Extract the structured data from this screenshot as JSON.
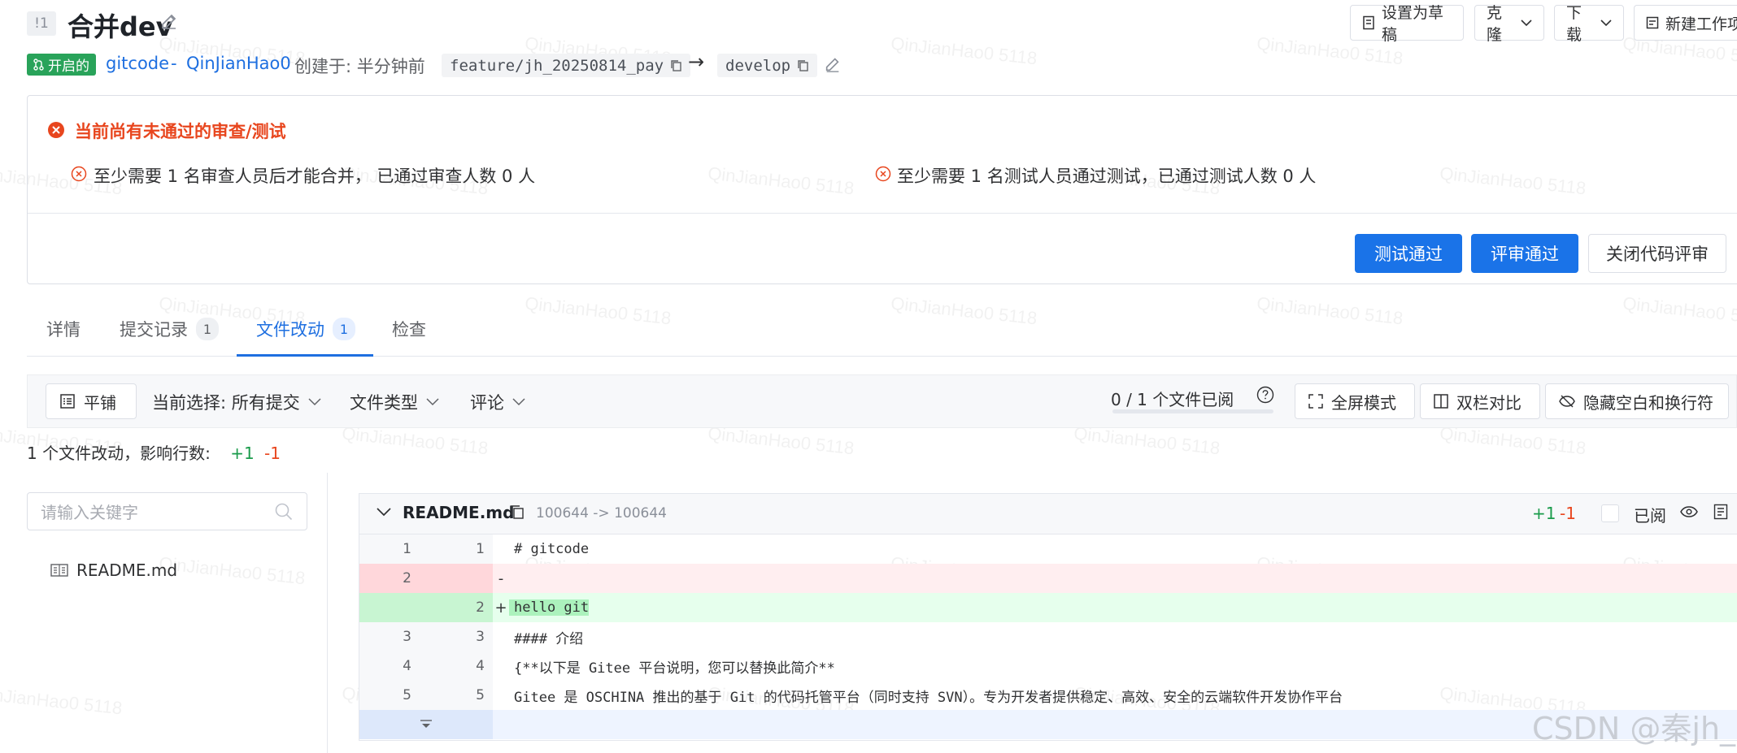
{
  "header": {
    "mr_id": "!1",
    "title": "合并dev",
    "actions": [
      "设置为草稿",
      "克隆",
      "下载",
      "新建工作项"
    ]
  },
  "meta": {
    "status": "开启的",
    "repo": "gitcode",
    "separator": "-",
    "author": "QinJianHao0",
    "created": "创建于: 半分钟前",
    "source_branch": "feature/jh_20250814_pay",
    "arrow": "→",
    "target_branch": "develop"
  },
  "review": {
    "title": "当前尚有未通过的审查/测试",
    "reviewer_rule": "至少需要 1 名审查人员后才能合并， 已通过审查人数 0 人",
    "tester_rule": "至少需要 1 名测试人员通过测试，已通过测试人数 0 人",
    "buttons": [
      "测试通过",
      "评审通过",
      "关闭代码评审"
    ]
  },
  "tabs": [
    {
      "label": "详情",
      "count": null
    },
    {
      "label": "提交记录",
      "count": "1"
    },
    {
      "label": "文件改动",
      "count": "1"
    },
    {
      "label": "检查",
      "count": null
    }
  ],
  "active_tab": "文件改动",
  "toolbar": {
    "layout_label": "平铺",
    "selection_label": "当前选择: 所有提交",
    "file_type_label": "文件类型",
    "comment_label": "评论",
    "viewed_text": "0 / 1 个文件已阅",
    "viewed_fraction": 0,
    "fullscreen_label": "全屏模式",
    "split_label": "双栏对比",
    "hide_whitespace_label": "隐藏空白和换行符"
  },
  "summary": {
    "text": "1 个文件改动，影响行数:",
    "additions": "+1",
    "deletions": "-1"
  },
  "sidebar": {
    "search_placeholder": "请输入关键字",
    "files": [
      "README.md"
    ]
  },
  "diff": {
    "filename": "README.md",
    "mode": "100644 -> 100644",
    "additions": "+1",
    "deletions": "-1",
    "viewed_label": "已阅",
    "lines": [
      {
        "old": "1",
        "new": "1",
        "type": "context",
        "sign": "",
        "text": "# gitcode"
      },
      {
        "old": "2",
        "new": "",
        "type": "del",
        "sign": "-",
        "text": ""
      },
      {
        "old": "",
        "new": "2",
        "type": "add",
        "sign": "+",
        "text": "hello git"
      },
      {
        "old": "3",
        "new": "3",
        "type": "context",
        "sign": "",
        "text": "#### 介绍"
      },
      {
        "old": "4",
        "new": "4",
        "type": "context",
        "sign": "",
        "text": "{**以下是 Gitee 平台说明，您可以替换此简介**"
      },
      {
        "old": "5",
        "new": "5",
        "type": "context",
        "sign": "",
        "text": "Gitee 是 OSCHINA 推出的基于 Git 的代码托管平台（同时支持 SVN）。专为开发者提供稳定、高效、安全的云端软件开发协作平台"
      }
    ]
  },
  "watermark": "QinJianHao0 5118",
  "csdn_mark": "CSDN @秦jh_",
  "colors": {
    "primary": "#1a73e8",
    "success": "#29a35a",
    "danger": "#e8461e",
    "add_bg": "#e6ffed",
    "del_bg": "#ffeef0"
  }
}
